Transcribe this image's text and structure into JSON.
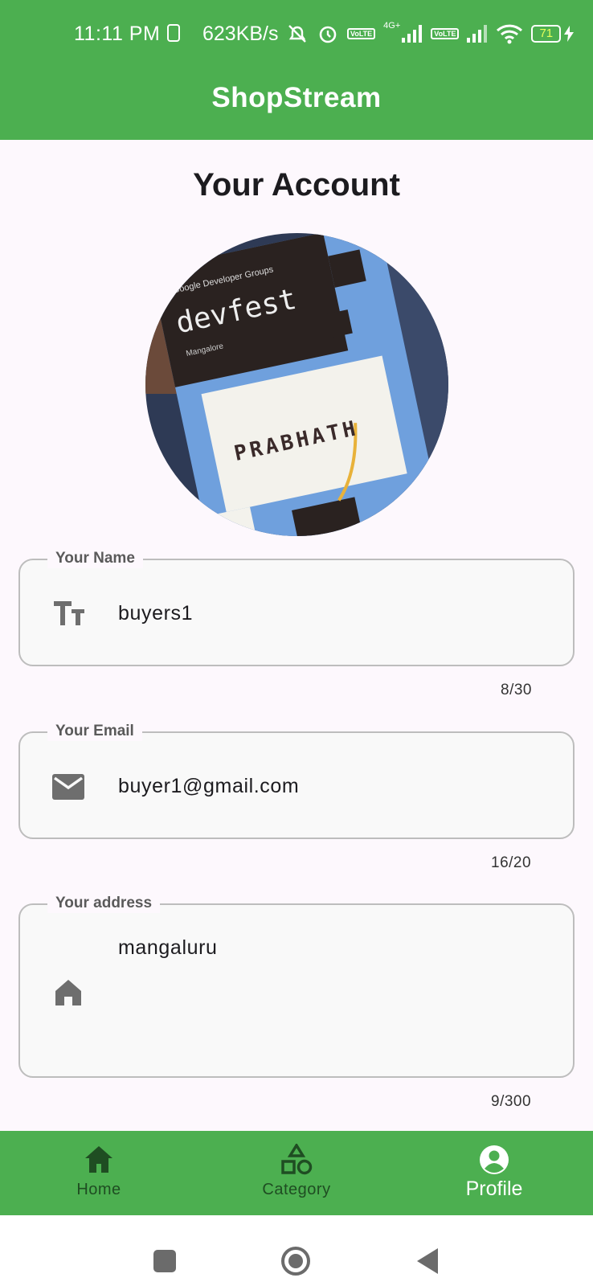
{
  "status_bar": {
    "time": "11:11 PM",
    "net_speed": "623KB/s",
    "network_label": "4G+",
    "volte_label": "Vo LTE",
    "battery": "71"
  },
  "app_bar": {
    "title": "ShopStream"
  },
  "page": {
    "title": "Your Account",
    "avatar_text": {
      "brand": "Google Developer Groups",
      "event": "devfest",
      "city": "Mangalore",
      "name": "PRABHATH"
    }
  },
  "form": {
    "name": {
      "label": "Your Name",
      "value": "buyers1",
      "counter": "8/30",
      "icon": "text-fields-icon"
    },
    "email": {
      "label": "Your Email",
      "value": "buyer1@gmail.com",
      "counter": "16/20",
      "icon": "email-icon"
    },
    "address": {
      "label": "Your address",
      "value": "mangaluru",
      "counter": "9/300",
      "icon": "home-icon"
    }
  },
  "bottom_nav": {
    "items": [
      {
        "label": "Home",
        "icon": "home-icon",
        "active": false
      },
      {
        "label": "Category",
        "icon": "category-icon",
        "active": false
      },
      {
        "label": "Profile",
        "icon": "account-circle-icon",
        "active": true
      }
    ]
  },
  "colors": {
    "primary": "#4caf50",
    "inactive_nav": "#1f4d22",
    "background": "#fdf8fd",
    "field_border": "#bdbdbd"
  }
}
